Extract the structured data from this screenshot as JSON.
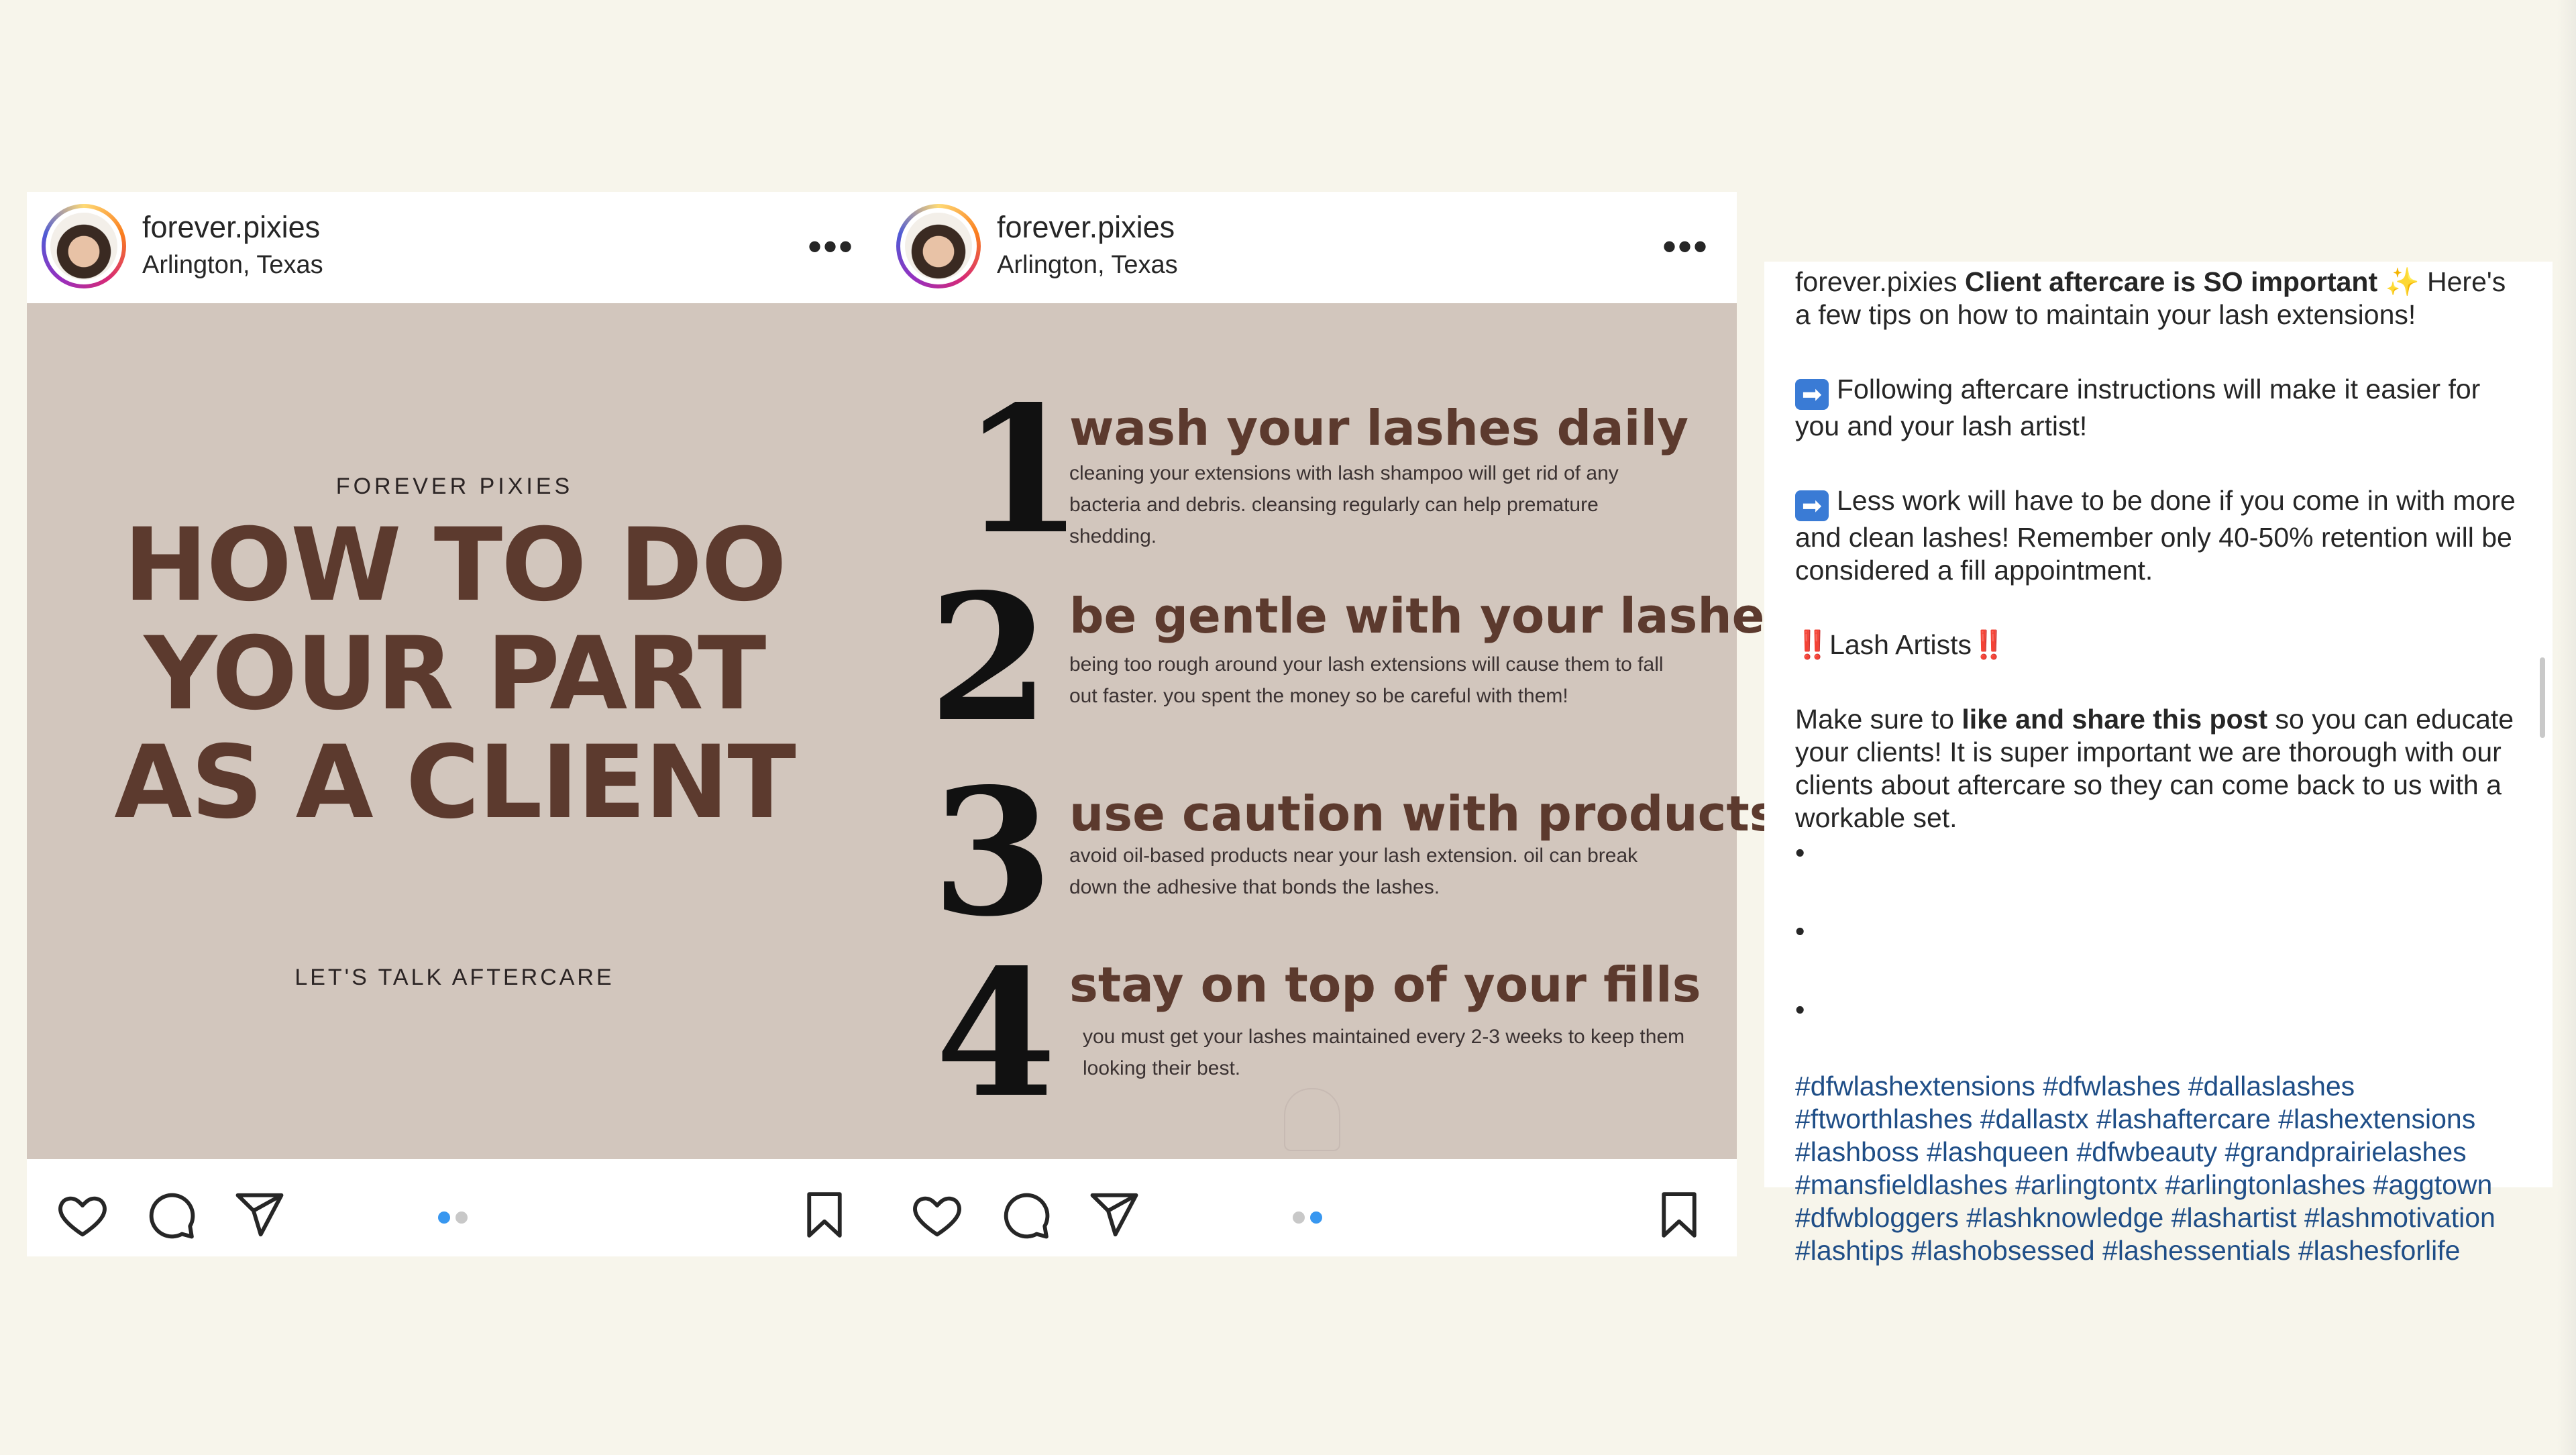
{
  "posts": [
    {
      "username": "forever.pixies",
      "location": "Arlington, Texas",
      "more": "•••",
      "brand": "FOREVER PIXIES",
      "title": "HOW TO DO YOUR PART AS A CLIENT",
      "subtitle": "LET'S TALK AFTERCARE",
      "active_dot": 0
    },
    {
      "username": "forever.pixies",
      "location": "Arlington, Texas",
      "more": "•••",
      "active_dot": 1,
      "steps": [
        {
          "num": "1",
          "title": "wash your lashes daily",
          "desc": "cleaning your extensions with lash shampoo will get rid of any bacteria and debris. cleansing regularly can help premature shedding."
        },
        {
          "num": "2",
          "title": "be gentle with your lashes",
          "desc": "being too rough around your lash extensions will cause them to fall out faster. you spent the money so be careful with them!"
        },
        {
          "num": "3",
          "title": "use caution with products",
          "desc": "avoid oil-based products near your lash extension. oil can break down the adhesive that bonds the lashes."
        },
        {
          "num": "4",
          "title": "stay on top of your fills",
          "desc": "you must get your lashes maintained every 2-3 weeks to keep them looking their best."
        }
      ]
    }
  ],
  "caption": {
    "username": "forever.pixies",
    "lead_bold": "Client aftercare is SO important",
    "sparkle": "✨",
    "lead_rest": "Here's a few tips on how to maintain your lash extensions!",
    "arrow": "➡",
    "point1": "Following aftercare instructions will make it easier for you and your lash artist!",
    "point2": "Less work will have to be done if you come in with more  and clean lashes! Remember only 40-50% retention will be considered a fill appointment.",
    "bangs": "‼️",
    "artists": "Lash Artists",
    "make_sure": "Make sure to",
    "like_share": "like and share this post",
    "educate": "so you can educate your clients! It is super important we are thorough with our clients about aftercare so they can come back to us with a workable set.",
    "bullet": "•",
    "hashtags": "#dfwlashextensions #dfwlashes #dallaslashes #ftworthlashes #dallastx #lashaftercare #lashextensions #lashboss #lashqueen #dfwbeauty #grandprairielashes #mansfieldlashes #arlingtontx #arlingtonlashes #aggtown #dfwbloggers #lashknowledge #lashartist #lashmotivation #lashtips #lashobsessed #lashessentials #lashesforlife"
  }
}
